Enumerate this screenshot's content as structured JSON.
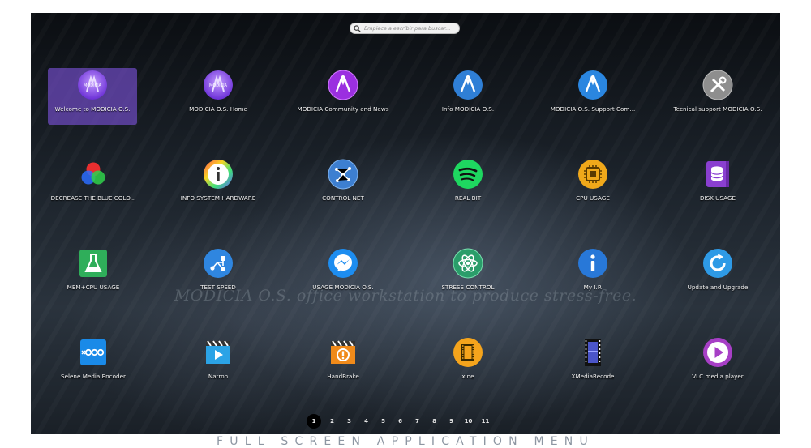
{
  "search": {
    "placeholder": "Empiece a escribir para buscar..."
  },
  "slogan": "MODICIA O.S. office workstation to produce stress-free.",
  "apps": [
    {
      "label": "Welcome to MODICIA O.S.",
      "icon": "modicia-logo-icon",
      "selected": true
    },
    {
      "label": "MODICIA O.S. Home",
      "icon": "modicia-logo-icon"
    },
    {
      "label": "MODICIA Community and News",
      "icon": "modicia-community-icon"
    },
    {
      "label": "Info MODICIA O.S.",
      "icon": "modicia-info-icon"
    },
    {
      "label": "MODICIA O.S. Support Com...",
      "icon": "modicia-support-icon"
    },
    {
      "label": "Tecnical support MODICIA O.S.",
      "icon": "tools-icon"
    },
    {
      "label": "DECREASE THE BLUE COLO...",
      "icon": "rgb-circles-icon"
    },
    {
      "label": "INFO SYSTEM HARDWARE",
      "icon": "info-rainbow-icon"
    },
    {
      "label": "CONTROL NET",
      "icon": "network-icon"
    },
    {
      "label": "REAL BIT",
      "icon": "spotify-wave-icon"
    },
    {
      "label": "CPU USAGE",
      "icon": "cpu-icon"
    },
    {
      "label": "DISK USAGE",
      "icon": "disk-database-icon"
    },
    {
      "label": "MEM+CPU USAGE",
      "icon": "flask-icon"
    },
    {
      "label": "TEST SPEED",
      "icon": "speed-network-icon"
    },
    {
      "label": "USAGE MODICIA O.S.",
      "icon": "messenger-bolt-icon"
    },
    {
      "label": "STRESS CONTROL",
      "icon": "atom-icon"
    },
    {
      "label": "My I.P.",
      "icon": "info-icon"
    },
    {
      "label": "Update and Upgrade",
      "icon": "refresh-icon"
    },
    {
      "label": "Selene Media Encoder",
      "icon": "selene-icon"
    },
    {
      "label": "Natron",
      "icon": "natron-clapper-icon"
    },
    {
      "label": "HandBrake",
      "icon": "handbrake-clapper-icon"
    },
    {
      "label": "xine",
      "icon": "film-reel-icon"
    },
    {
      "label": "XMediaRecode",
      "icon": "film-strip-icon"
    },
    {
      "label": "VLC media player",
      "icon": "play-button-icon"
    }
  ],
  "pages": [
    "1",
    "2",
    "3",
    "4",
    "5",
    "6",
    "7",
    "8",
    "9",
    "10",
    "11"
  ],
  "active_page": "1",
  "caption": "FULL SCREEN APPLICATION MENU"
}
